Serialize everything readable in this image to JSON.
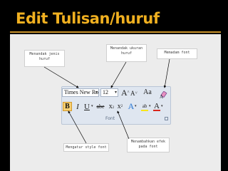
{
  "slide": {
    "title": "Edit Tulisan/huruf"
  },
  "callouts": {
    "font_type": "Menandak jenis huruf",
    "font_size": "Menandak ukuran huruf",
    "clear_format": "Memadam font",
    "font_style": "Mengatur style font",
    "text_effect": "Menambahkan efek pada font"
  },
  "ribbon": {
    "font_name": "Times New Rom",
    "font_size": "12",
    "grow_font": "A",
    "shrink_font": "A",
    "change_case": "Aa",
    "bold": "B",
    "italic": "I",
    "underline": "U",
    "strikethrough": "abe",
    "subscript": "x",
    "superscript": "x",
    "text_effect_letter": "A",
    "highlight_letter": "ab",
    "font_color_letter": "A",
    "group_label": "Font"
  },
  "colors": {
    "title": "#f0b020",
    "accent_rule": "#c8922a",
    "bold_active": "#f6cf72",
    "highlight": "#f7e51c",
    "font_color": "#d8261c"
  },
  "icons": {
    "clear_formatting": "eraser-icon",
    "dialog_launcher": "launcher-icon",
    "dropdown": "chevron-down-icon"
  }
}
